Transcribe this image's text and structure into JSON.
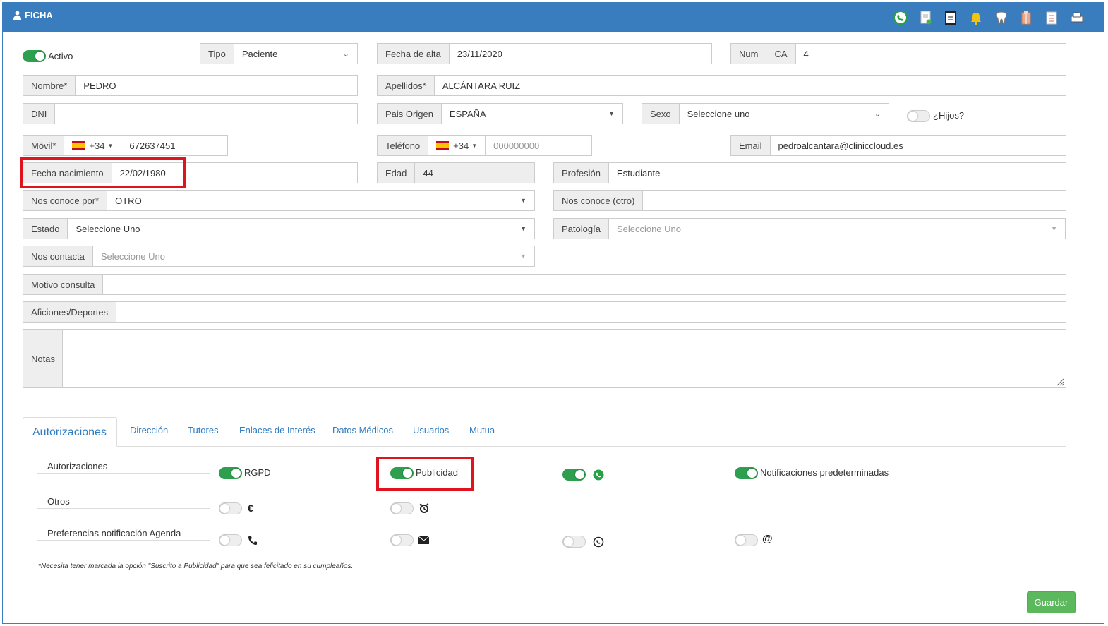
{
  "header": {
    "title": "FICHA"
  },
  "form": {
    "activo_label": "Activo",
    "tipo": {
      "label": "Tipo",
      "value": "Paciente"
    },
    "fecha_alta": {
      "label": "Fecha de alta",
      "value": "23/11/2020"
    },
    "num": {
      "label": "Num",
      "prefix": "CA",
      "value": "4"
    },
    "nombre": {
      "label": "Nombre*",
      "value": "PEDRO"
    },
    "apellidos": {
      "label": "Apellidos*",
      "value": "ALCÁNTARA RUIZ"
    },
    "dni": {
      "label": "DNI",
      "value": ""
    },
    "pais_origen": {
      "label": "Pais Origen",
      "value": "ESPAÑA"
    },
    "sexo": {
      "label": "Sexo",
      "value": "Seleccione uno"
    },
    "hijos_label": "¿Hijos?",
    "movil": {
      "label": "Móvil*",
      "code": "+34",
      "value": "672637451"
    },
    "telefono": {
      "label": "Teléfono",
      "code": "+34",
      "placeholder": "000000000"
    },
    "email": {
      "label": "Email",
      "value": "pedroalcantara@cliniccloud.es"
    },
    "fecha_nacimiento": {
      "label": "Fecha nacimiento",
      "value": "22/02/1980"
    },
    "edad": {
      "label": "Edad",
      "value": "44"
    },
    "profesion": {
      "label": "Profesión",
      "value": "Estudiante"
    },
    "nos_conoce_por": {
      "label": "Nos conoce por*",
      "value": "OTRO"
    },
    "nos_conoce_otro": {
      "label": "Nos conoce (otro)",
      "value": ""
    },
    "estado": {
      "label": "Estado",
      "value": "Seleccione Uno"
    },
    "patologia": {
      "label": "Patología",
      "placeholder": "Seleccione Uno"
    },
    "nos_contacta": {
      "label": "Nos contacta",
      "placeholder": "Seleccione Uno"
    },
    "motivo_consulta": {
      "label": "Motivo consulta",
      "value": ""
    },
    "aficiones": {
      "label": "Aficiones/Deportes",
      "value": ""
    },
    "notas": {
      "label": "Notas",
      "value": ""
    }
  },
  "tabs": [
    "Autorizaciones",
    "Dirección",
    "Tutores",
    "Enlaces de Interés",
    "Datos Médicos",
    "Usuarios",
    "Mutua"
  ],
  "auth": {
    "row1_label": "Autorizaciones",
    "rgpd": "RGPD",
    "publicidad": "Publicidad",
    "notificaciones": "Notificaciones predeterminadas",
    "row2_label": "Otros",
    "row3_label": "Preferencias notificación Agenda",
    "note": "*Necesita tener marcada la opción \"Suscrito a Publicidad\" para que sea felicitado en su cumpleaños."
  },
  "guardar": "Guardar",
  "colors": {
    "header": "#3a7dbf",
    "switch_on": "#2e9f4e",
    "highlight": "#e0141e",
    "tab": "#2f7cc1",
    "save": "#5cb85c"
  }
}
